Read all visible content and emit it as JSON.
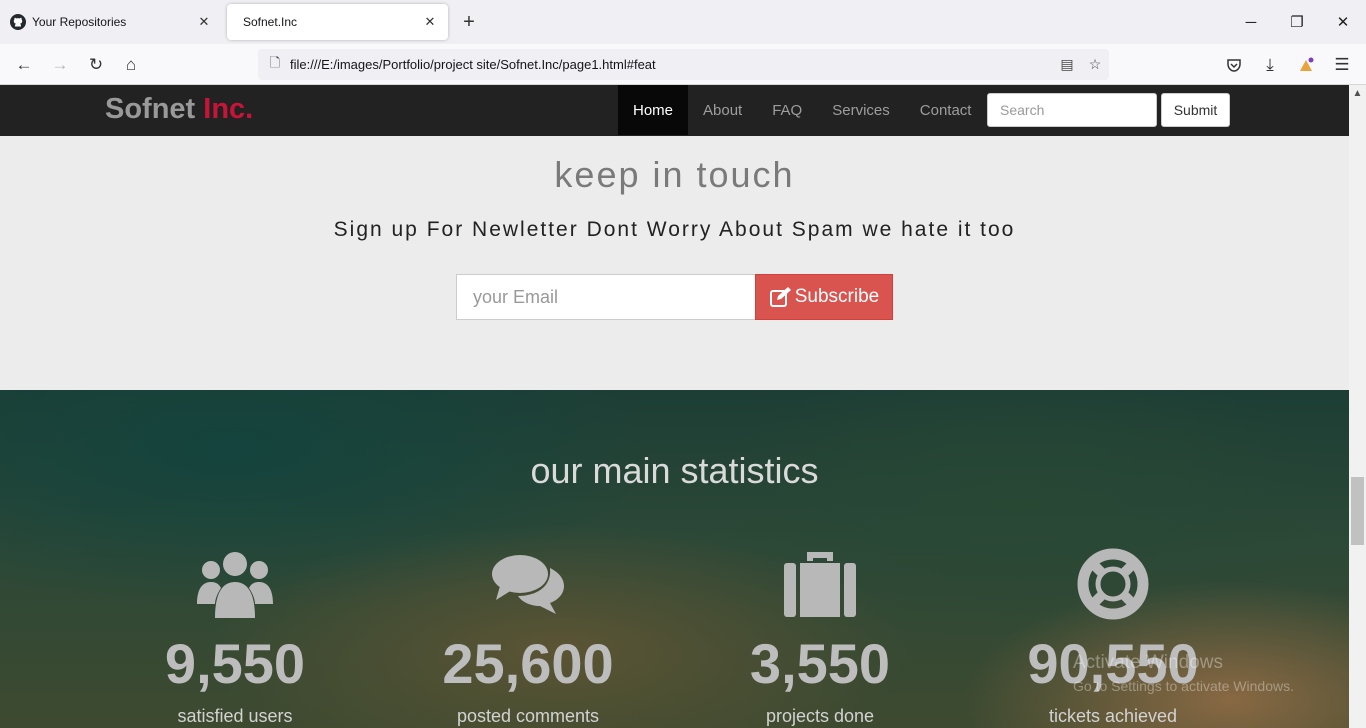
{
  "browser": {
    "tabs": [
      {
        "title": "Your Repositories",
        "icon": "github-icon"
      },
      {
        "title": "Sofnet.Inc",
        "icon": ""
      }
    ],
    "url": "file:///E:/images/Portfolio/project site/Sofnet.Inc/page1.html#feat"
  },
  "site": {
    "brand_main": "Sofnet",
    "brand_accent": "Inc.",
    "brand_accent_color": "#c9143a",
    "menu": [
      "Home",
      "About",
      "FAQ",
      "Services",
      "Contact"
    ],
    "active_menu": "Home",
    "search_placeholder": "Search",
    "submit_label": "Submit"
  },
  "newsletter": {
    "title": "keep in touch",
    "subtitle": "Sign up For Newletter Dont Worry About Spam we hate it too",
    "email_placeholder": "your Email",
    "subscribe_label": "Subscribe",
    "subscribe_color": "#d9534f"
  },
  "stats": {
    "title": "our main statistics",
    "items": [
      {
        "icon": "users-icon",
        "number": "9,550",
        "label": "satisfied users"
      },
      {
        "icon": "comments-icon",
        "number": "25,600",
        "label": "posted comments"
      },
      {
        "icon": "briefcase-icon",
        "number": "3,550",
        "label": "projects done"
      },
      {
        "icon": "life-ring-icon",
        "number": "90,550",
        "label": "tickets achieved"
      }
    ]
  },
  "watermark": {
    "line1": "Activate Windows",
    "line2": "Go to Settings to activate Windows."
  }
}
